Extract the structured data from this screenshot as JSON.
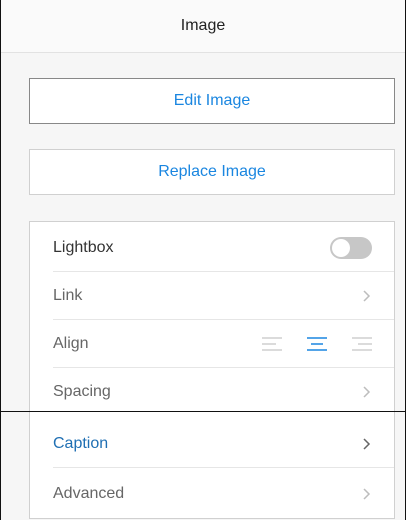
{
  "header": {
    "title": "Image"
  },
  "buttons": {
    "edit_label": "Edit Image",
    "replace_label": "Replace Image"
  },
  "settings": {
    "lightbox_label": "Lightbox",
    "lightbox_enabled": false,
    "link_label": "Link",
    "align_label": "Align",
    "align_selected": "center",
    "spacing_label": "Spacing",
    "caption_label": "Caption",
    "advanced_label": "Advanced"
  },
  "colors": {
    "accent": "#1a86e0",
    "caption": "#1f6fb3",
    "toggle_off": "#c7c7c7"
  },
  "icons": {
    "chevron": "chevron-right-icon",
    "align_left": "align-left-icon",
    "align_center": "align-center-icon",
    "align_right": "align-right-icon"
  }
}
